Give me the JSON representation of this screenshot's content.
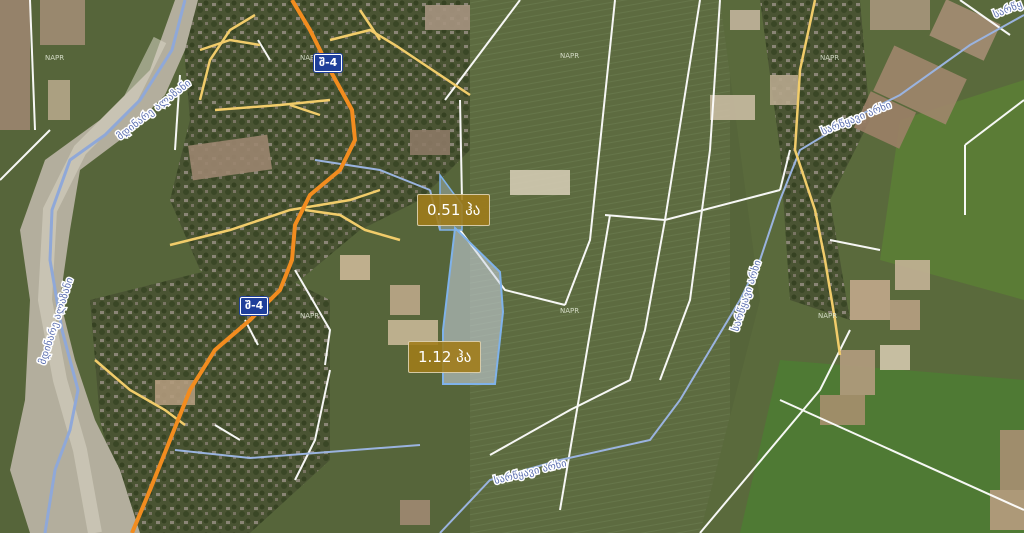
{
  "map": {
    "road_shields": [
      {
        "id": "shield-1",
        "label": "შ-4"
      },
      {
        "id": "shield-2",
        "label": "შ-4"
      }
    ],
    "river_labels": {
      "left_upper": "მდინარე ალაზანი",
      "left_lower": "მდინარე ალაზანი",
      "canal_right": "სარწყავი არხი",
      "canal_vertical": "სარწყავი არხი",
      "canal_bottom": "სარწყავი არხი",
      "corner": "სარწყ"
    },
    "napr_labels": [
      "NAPR",
      "NAPR",
      "NAPR",
      "NAPR",
      "NAPR",
      "NAPR"
    ],
    "parcels": [
      {
        "label": "0.51 ჰა"
      },
      {
        "label": "1.12 ჰა"
      }
    ],
    "colors": {
      "road_major": "#f28c1f",
      "road_minor": "#f1cc6a",
      "river": "#8fa8d8",
      "parcel_outline": "#7fb2ea",
      "parcel_label_bg": "#a07c19",
      "cadastral_line": "#ffffff"
    }
  }
}
